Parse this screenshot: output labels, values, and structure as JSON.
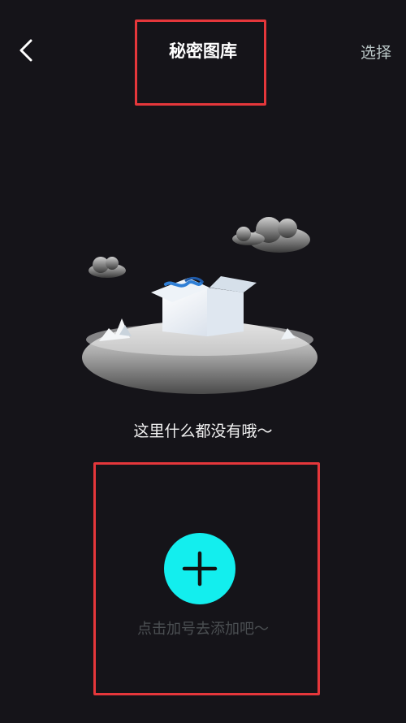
{
  "header": {
    "back_icon": "chevron-left-icon",
    "title": "秘密图库",
    "select_label": "选择"
  },
  "empty_state": {
    "illustration": "open-box-on-island-with-clouds",
    "message": "这里什么都没有哦～"
  },
  "add": {
    "icon": "plus-icon",
    "hint": "点击加号去添加吧～",
    "accent_color": "#13eeee"
  },
  "colors": {
    "background": "#151419",
    "highlight_border": "#e5373b"
  }
}
